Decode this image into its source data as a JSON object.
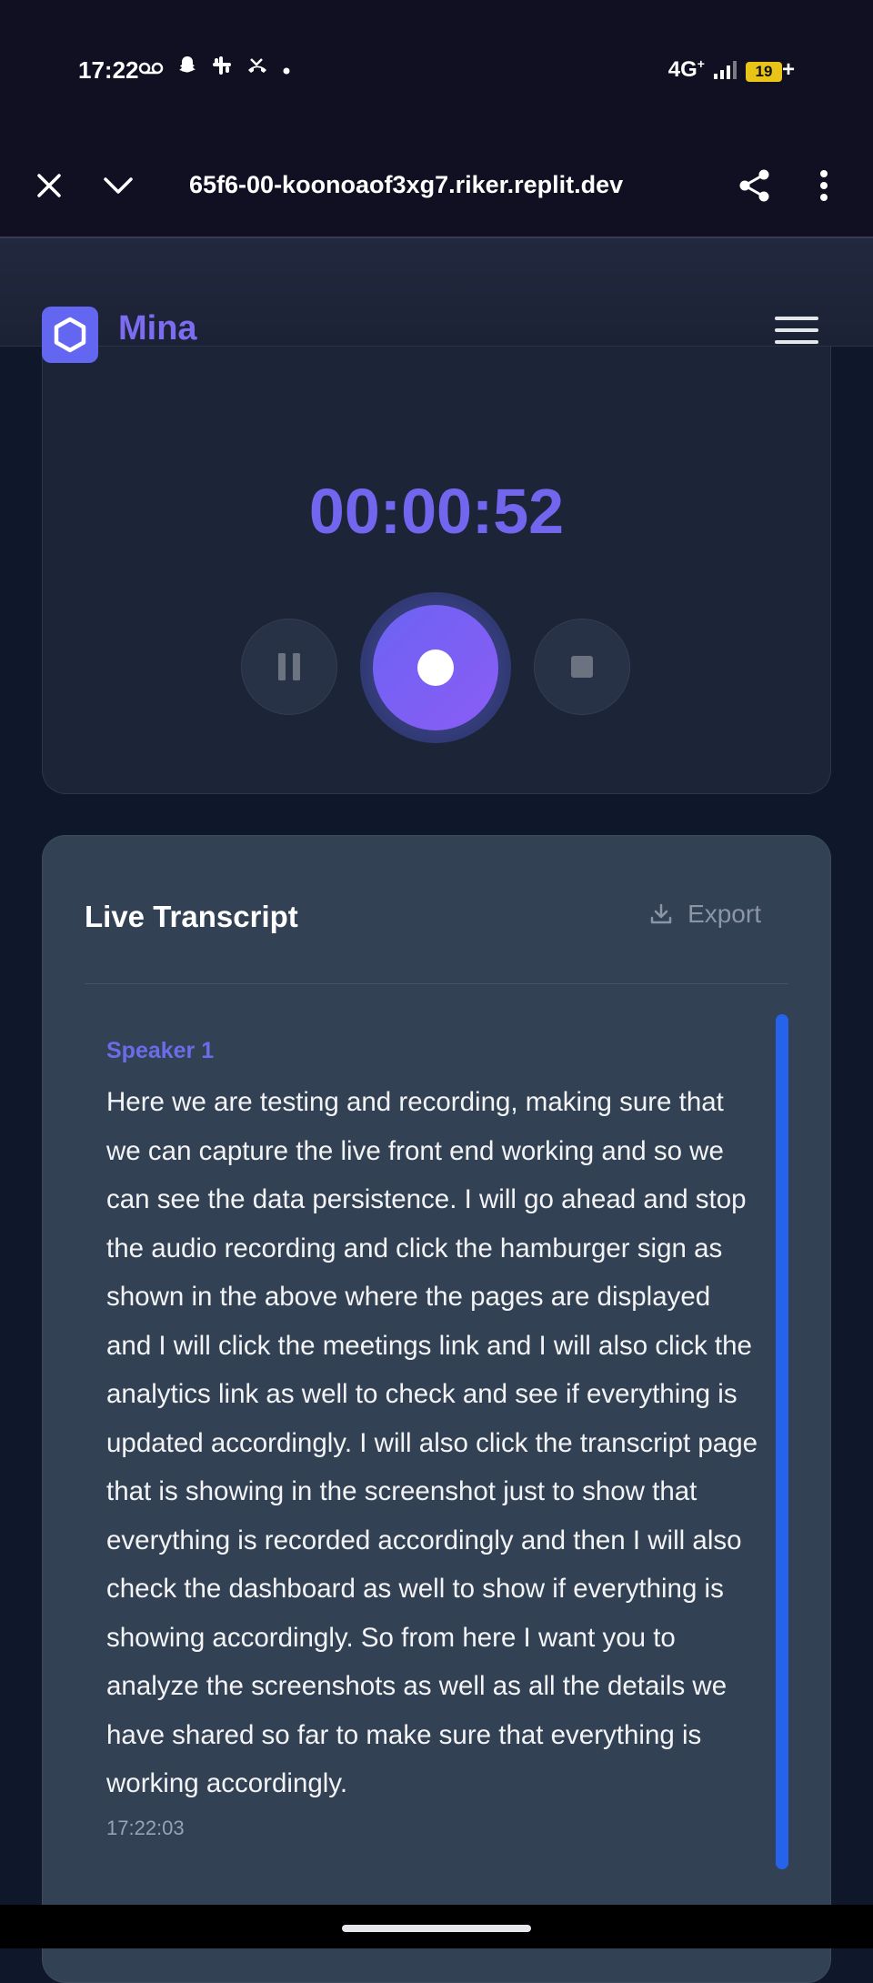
{
  "status_bar": {
    "time": "17:22",
    "network": "4G",
    "network_sup": "+",
    "battery": "19",
    "battery_suffix": "+",
    "icons": [
      "voicemail-icon",
      "snapchat-icon",
      "slack-icon",
      "missed-call-icon",
      "dot-icon",
      "signal-icon",
      "battery-icon"
    ]
  },
  "browser": {
    "url": "65f6-00-koonoaof3xg7.riker.replit.dev"
  },
  "app": {
    "brand": "Mina"
  },
  "recorder": {
    "timer": "00:00:52"
  },
  "transcript": {
    "title": "Live Transcript",
    "export_label": "Export",
    "entries": [
      {
        "speaker": "Speaker 1",
        "text": "Here we are testing and recording, making sure that we can capture the live front end working and so we can see the data persistence. I will go ahead and stop the audio recording and click the hamburger sign as shown in the above where the pages are displayed and I will click the meetings link and I will also click the analytics link as well to check and see if everything is updated accordingly. I will also click the transcript page that is showing in the screenshot just to show that everything is recorded accordingly and then I will also check the dashboard as well to show if everything is showing accordingly. So from here I want you to analyze the screenshots as well as all the details we have shared so far to make sure that everything is working accordingly.",
        "time": "17:22:03"
      }
    ]
  },
  "colors": {
    "accent": "#6366f1",
    "timer": "#7366ee",
    "scrollbar": "#2563eb",
    "background": "#0f172a"
  }
}
